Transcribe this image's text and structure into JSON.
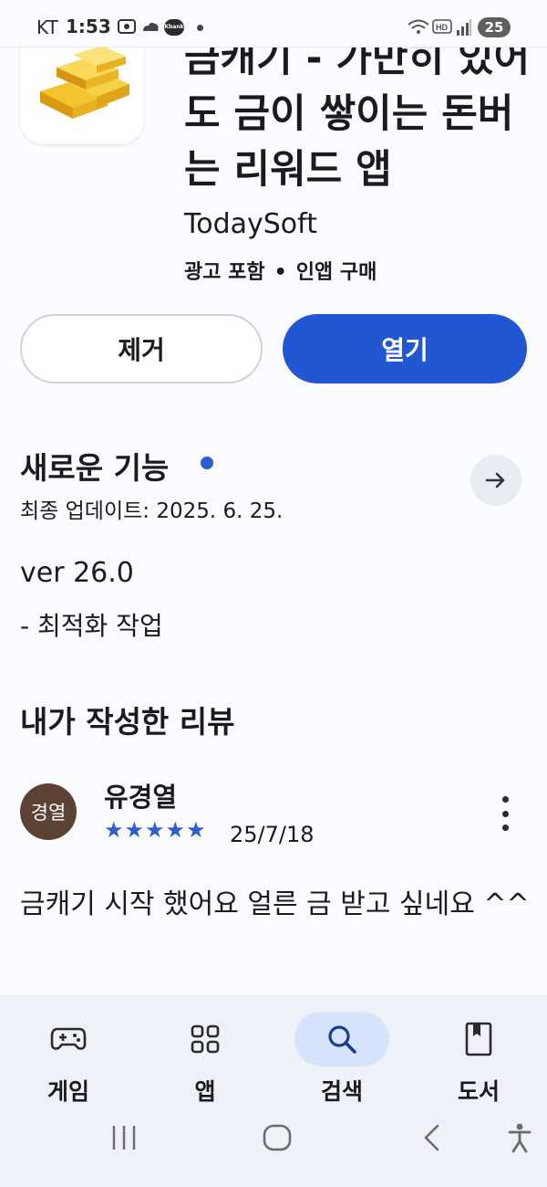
{
  "status_bar": {
    "carrier": "KT",
    "time": "1:53",
    "kbank_label": "Kbank",
    "battery": "25"
  },
  "app": {
    "title": "금캐기 - 가만히 있어도 금이 쌓이는 돈버는 리워드 앱",
    "developer": "TodaySoft",
    "ads": "광고 포함",
    "iap": "인앱 구매",
    "remove_label": "제거",
    "open_label": "열기"
  },
  "whats_new": {
    "title": "새로운 기능",
    "last_updated": "최종 업데이트: 2025. 6. 25.",
    "version": "ver 26.0",
    "changes": "- 최적화 작업"
  },
  "my_review": {
    "title": "내가 작성한 리뷰",
    "avatar_text": "경열",
    "reviewer": "유경열",
    "rating": 5,
    "stars": "★★★★★",
    "date": "25/7/18",
    "text": "금캐기 시작 했어요 얼른 금 받고 싶네요 ^^"
  },
  "bottom_nav": {
    "items": [
      {
        "label": "게임",
        "icon": "gamepad-icon"
      },
      {
        "label": "앱",
        "icon": "apps-grid-icon"
      },
      {
        "label": "검색",
        "icon": "search-icon",
        "active": true
      },
      {
        "label": "도서",
        "icon": "book-icon"
      }
    ]
  },
  "colors": {
    "accent": "#2257d3",
    "star": "#2d5ed1",
    "nav_bg": "#eef1f8",
    "active_pill": "#d5e3fb",
    "avatar_bg": "#5b4234"
  }
}
